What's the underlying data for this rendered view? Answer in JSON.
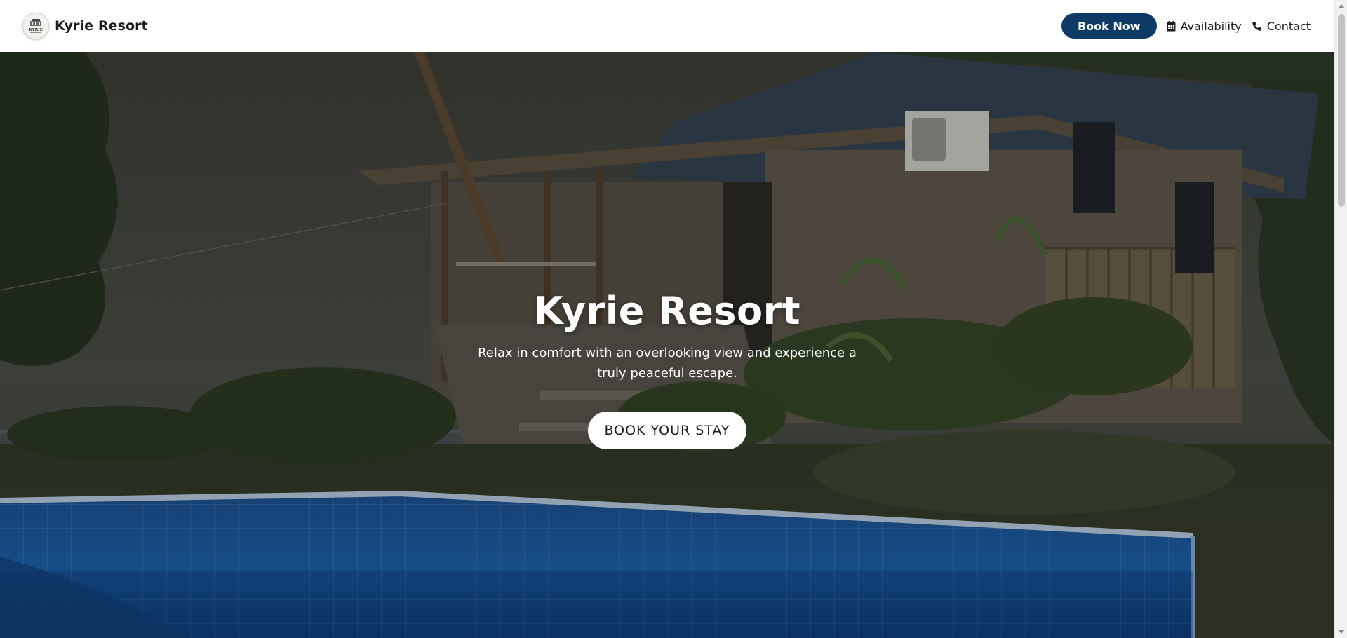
{
  "header": {
    "brand_name": "Kyrie Resort",
    "logo_text": "KYRIE",
    "book_now_label": "Book Now",
    "availability_label": "Availability",
    "contact_label": "Contact"
  },
  "hero": {
    "title": "Kyrie Resort",
    "subtitle": "Relax in comfort with an overlooking view and experience a truly peaceful escape.",
    "cta_label": "BOOK YOUR STAY"
  },
  "icons": {
    "availability": "calendar-icon",
    "contact": "phone-icon"
  },
  "colors": {
    "primary": "#0e3b66",
    "pool": "#1f5fa8"
  }
}
